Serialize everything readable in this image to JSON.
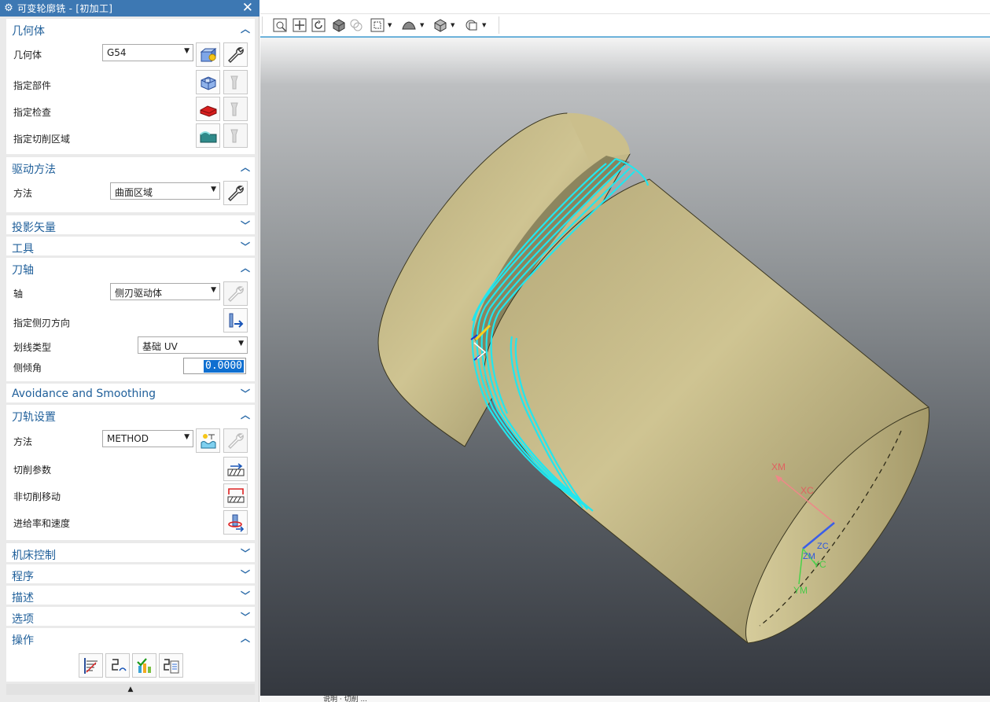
{
  "dialog": {
    "title": "可变轮廓铣 - [初加工]",
    "sections": {
      "geometry": {
        "header": "几何体",
        "geometry_label": "几何体",
        "geometry_value": "G54",
        "specify_part": "指定部件",
        "specify_check": "指定检查",
        "specify_cut_area": "指定切削区域"
      },
      "drive": {
        "header": "驱动方法",
        "method_label": "方法",
        "method_value": "曲面区域"
      },
      "projection": {
        "header": "投影矢量"
      },
      "tool": {
        "header": "工具"
      },
      "tool_axis": {
        "header": "刀轴",
        "axis_label": "轴",
        "axis_value": "侧刃驱动体",
        "side_dir_label": "指定侧刃方向",
        "ruling_label": "划线类型",
        "ruling_value": "基础 UV",
        "tilt_label": "侧倾角",
        "tilt_value": "0.0000"
      },
      "avoidance": {
        "header": "Avoidance and Smoothing"
      },
      "path_settings": {
        "header": "刀轨设置",
        "method_label": "方法",
        "method_value": "METHOD",
        "cut_params": "切削参数",
        "non_cut_moves": "非切削移动",
        "feeds_speeds": "进给率和速度"
      },
      "machine_control": {
        "header": "机床控制"
      },
      "program": {
        "header": "程序"
      },
      "description": {
        "header": "描述"
      },
      "options": {
        "header": "选项"
      },
      "actions": {
        "header": "操作"
      }
    }
  },
  "viewport": {
    "axis_labels": {
      "xm": "XM",
      "xc": "XC",
      "zc": "ZC",
      "zm": "ZM",
      "yc": "YC",
      "ym": "YM"
    },
    "status_text": "说明 · 切削 ..."
  },
  "colors": {
    "titlebar": "#3d78b3",
    "section_header_text": "#1f5f9a",
    "toolpath": "#22e6ee",
    "part": "#c9bd8a"
  }
}
